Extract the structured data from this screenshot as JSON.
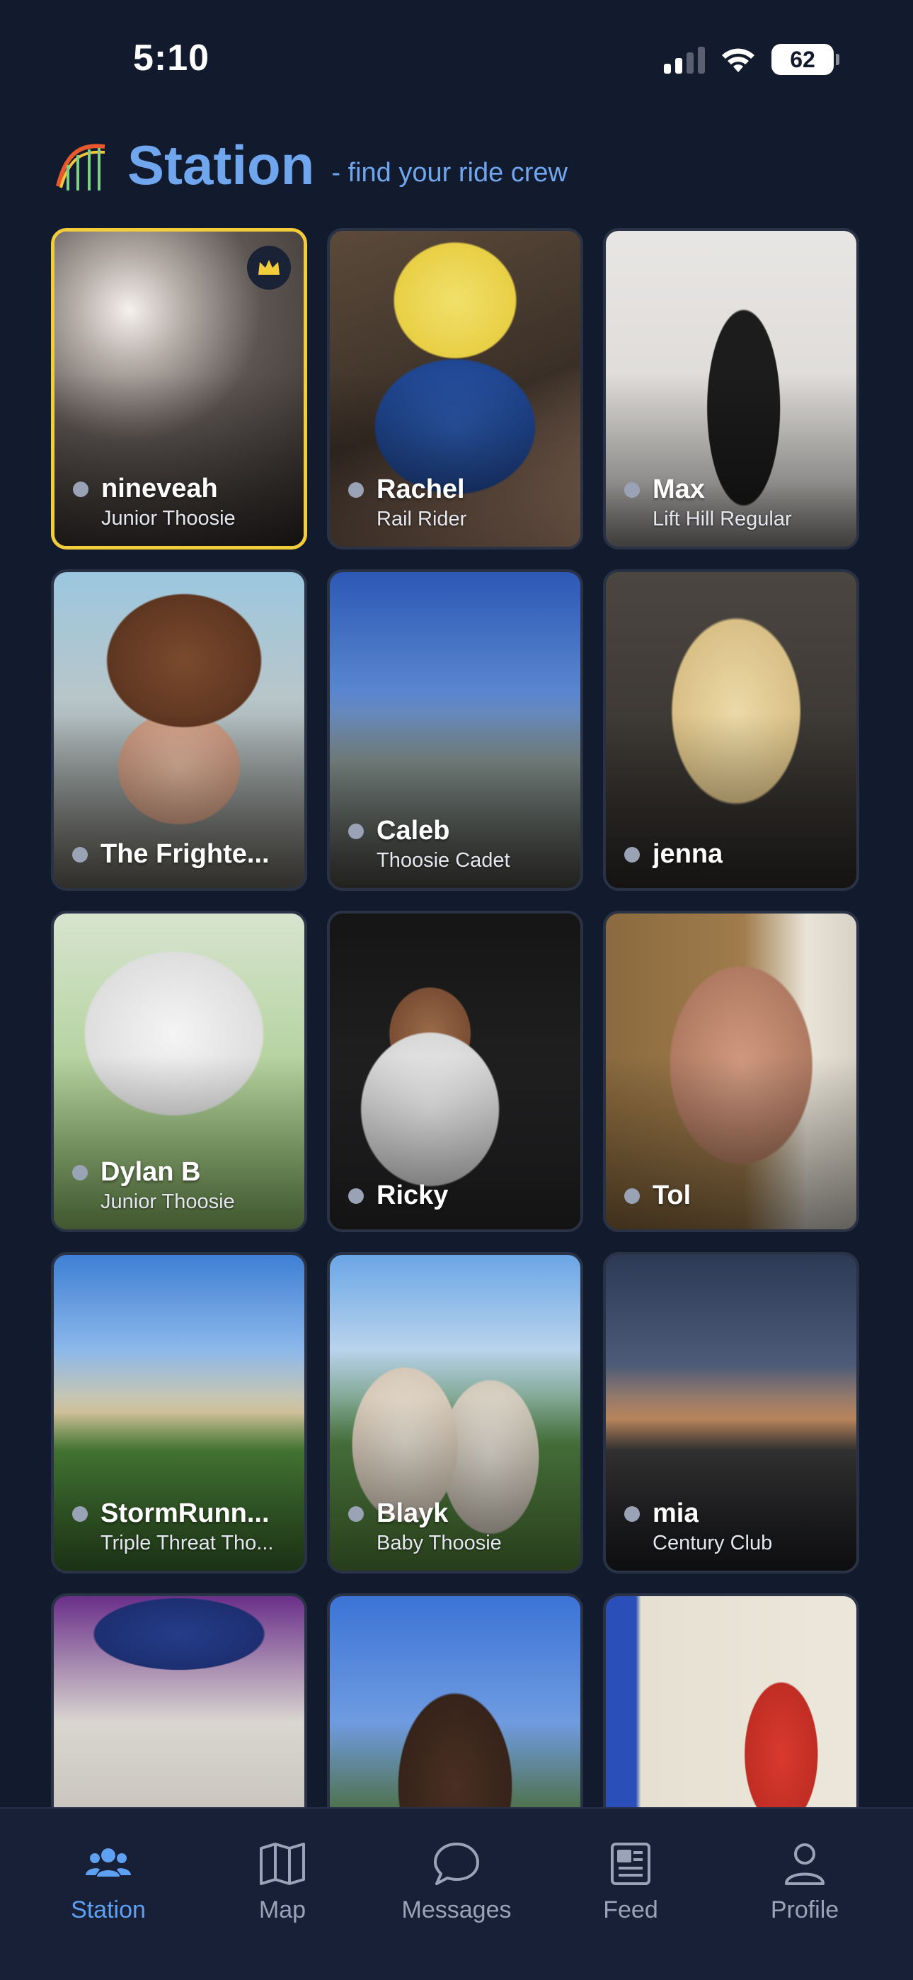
{
  "status": {
    "time": "5:10",
    "battery": "62"
  },
  "header": {
    "title": "Station",
    "tagline": "- find your ride crew"
  },
  "colors": {
    "accent": "#5ea0f2",
    "background": "#121a2d",
    "highlight_border": "#f2cc3a"
  },
  "cards": [
    {
      "name": "nineveah",
      "subtitle": "Junior Thoosie",
      "crown": true
    },
    {
      "name": "Rachel",
      "subtitle": "Rail Rider"
    },
    {
      "name": "Max",
      "subtitle": "Lift Hill Regular"
    },
    {
      "name": "The Frighte...",
      "subtitle": ""
    },
    {
      "name": "Caleb",
      "subtitle": "Thoosie Cadet"
    },
    {
      "name": "jenna",
      "subtitle": ""
    },
    {
      "name": "Dylan B",
      "subtitle": "Junior Thoosie"
    },
    {
      "name": "Ricky",
      "subtitle": ""
    },
    {
      "name": "Tol",
      "subtitle": ""
    },
    {
      "name": "StormRunn...",
      "subtitle": "Triple Threat Tho..."
    },
    {
      "name": "Blayk",
      "subtitle": "Baby Thoosie"
    },
    {
      "name": "mia",
      "subtitle": "Century Club"
    },
    {
      "name": "",
      "subtitle": ""
    },
    {
      "name": "",
      "subtitle": ""
    },
    {
      "name": "",
      "subtitle": ""
    }
  ],
  "tabs": [
    {
      "label": "Station",
      "icon": "users-icon",
      "active": true
    },
    {
      "label": "Map",
      "icon": "map-icon"
    },
    {
      "label": "Messages",
      "icon": "chat-bubble-icon"
    },
    {
      "label": "Feed",
      "icon": "newspaper-icon"
    },
    {
      "label": "Profile",
      "icon": "person-icon"
    }
  ]
}
